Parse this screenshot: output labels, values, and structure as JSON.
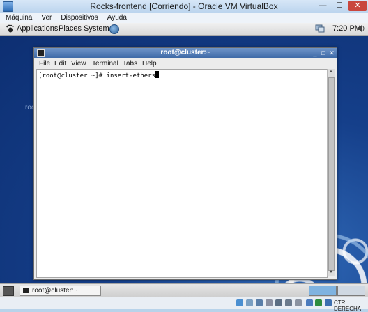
{
  "vbox": {
    "title": "Rocks-frontend [Corriendo] - Oracle VM VirtualBox",
    "menu": [
      "Máquina",
      "Ver",
      "Dispositivos",
      "Ayuda"
    ],
    "host_key": "CTRL DERECHA"
  },
  "panel": {
    "menus": [
      "Applications",
      "Places",
      "System"
    ],
    "clock": "7:20 PM"
  },
  "desktop": {
    "ghost_text": "roo"
  },
  "terminal": {
    "title": "root@cluster:~",
    "menu": [
      "File",
      "Edit",
      "View",
      "Terminal",
      "Tabs",
      "Help"
    ],
    "prompt": "[root@cluster ~]# ",
    "command": "insert-ethers"
  },
  "taskbar": {
    "task_label": "root@cluster:~"
  },
  "colors": {
    "titlebar_terminal": "#4f77b0",
    "desktop_blue": "#153f8a",
    "vbox_close": "#c9463d"
  },
  "icons": [
    "virtualbox-icon",
    "gnome-foot-icon",
    "globe-icon",
    "network-monitor-icon",
    "audio-icon",
    "terminal-icon",
    "show-desktop-icon"
  ]
}
